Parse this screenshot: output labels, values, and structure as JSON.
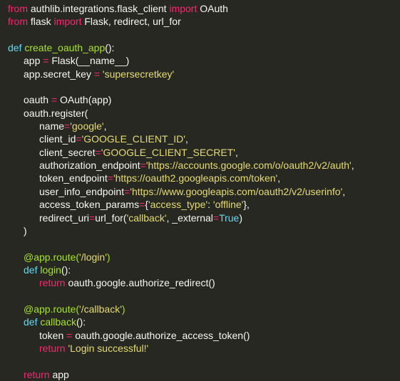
{
  "editor": {
    "language": "python",
    "colors": {
      "background": "#272822",
      "plain": "#f8f8f2",
      "keyword": "#f92672",
      "function": "#a6e22e",
      "string": "#e6db74",
      "operator": "#f92672",
      "builtin": "#66d9ef",
      "decorator": "#a6e22e"
    },
    "lines": [
      {
        "indent": 0,
        "tokens": [
          [
            "kw",
            "from"
          ],
          [
            "pl",
            " authlib.integrations.flask_client "
          ],
          [
            "kw",
            "import"
          ],
          [
            "pl",
            " OAuth"
          ]
        ]
      },
      {
        "indent": 0,
        "tokens": [
          [
            "kw",
            "from"
          ],
          [
            "pl",
            " flask "
          ],
          [
            "kw",
            "import"
          ],
          [
            "pl",
            " Flask, redirect, url_for"
          ]
        ]
      },
      {
        "indent": 0,
        "tokens": []
      },
      {
        "indent": 0,
        "tokens": [
          [
            "bi",
            "def"
          ],
          [
            "pl",
            " "
          ],
          [
            "fn",
            "create_oauth_app"
          ],
          [
            "pl",
            "():"
          ]
        ]
      },
      {
        "indent": 1,
        "tokens": [
          [
            "pl",
            "app "
          ],
          [
            "op",
            "="
          ],
          [
            "pl",
            " Flask(__name__)"
          ]
        ]
      },
      {
        "indent": 1,
        "tokens": [
          [
            "pl",
            "app.secret_key "
          ],
          [
            "op",
            "="
          ],
          [
            "pl",
            " "
          ],
          [
            "str",
            "'supersecretkey'"
          ]
        ]
      },
      {
        "indent": 0,
        "tokens": []
      },
      {
        "indent": 1,
        "tokens": [
          [
            "pl",
            "oauth "
          ],
          [
            "op",
            "="
          ],
          [
            "pl",
            " OAuth(app)"
          ]
        ]
      },
      {
        "indent": 1,
        "tokens": [
          [
            "pl",
            "oauth.register("
          ]
        ]
      },
      {
        "indent": 2,
        "tokens": [
          [
            "pl",
            "name"
          ],
          [
            "op",
            "="
          ],
          [
            "str",
            "'google'"
          ],
          [
            "pl",
            ","
          ]
        ]
      },
      {
        "indent": 2,
        "tokens": [
          [
            "pl",
            "client_id"
          ],
          [
            "op",
            "="
          ],
          [
            "str",
            "'GOOGLE_CLIENT_ID'"
          ],
          [
            "pl",
            ","
          ]
        ]
      },
      {
        "indent": 2,
        "tokens": [
          [
            "pl",
            "client_secret"
          ],
          [
            "op",
            "="
          ],
          [
            "str",
            "'GOOGLE_CLIENT_SECRET'"
          ],
          [
            "pl",
            ","
          ]
        ]
      },
      {
        "indent": 2,
        "tokens": [
          [
            "pl",
            "authorization_endpoint"
          ],
          [
            "op",
            "="
          ],
          [
            "str",
            "'https://accounts.google.com/o/oauth2/v2/auth'"
          ],
          [
            "pl",
            ","
          ]
        ]
      },
      {
        "indent": 2,
        "tokens": [
          [
            "pl",
            "token_endpoint"
          ],
          [
            "op",
            "="
          ],
          [
            "str",
            "'https://oauth2.googleapis.com/token'"
          ],
          [
            "pl",
            ","
          ]
        ]
      },
      {
        "indent": 2,
        "tokens": [
          [
            "pl",
            "user_info_endpoint"
          ],
          [
            "op",
            "="
          ],
          [
            "str",
            "'https://www.googleapis.com/oauth2/v2/userinfo'"
          ],
          [
            "pl",
            ","
          ]
        ]
      },
      {
        "indent": 2,
        "tokens": [
          [
            "pl",
            "access_token_params"
          ],
          [
            "op",
            "="
          ],
          [
            "pl",
            "{"
          ],
          [
            "str",
            "'access_type'"
          ],
          [
            "pl",
            ": "
          ],
          [
            "str",
            "'offline'"
          ],
          [
            "pl",
            "},"
          ]
        ]
      },
      {
        "indent": 2,
        "tokens": [
          [
            "pl",
            "redirect_uri"
          ],
          [
            "op",
            "="
          ],
          [
            "pl",
            "url_for("
          ],
          [
            "str",
            "'callback'"
          ],
          [
            "pl",
            ", _external"
          ],
          [
            "op",
            "="
          ],
          [
            "bi",
            "True"
          ],
          [
            "pl",
            ")"
          ]
        ]
      },
      {
        "indent": 1,
        "tokens": [
          [
            "pl",
            ")"
          ]
        ]
      },
      {
        "indent": 0,
        "tokens": []
      },
      {
        "indent": 1,
        "tokens": [
          [
            "dec",
            "@app.route("
          ],
          [
            "str",
            "'/login'"
          ],
          [
            "dec",
            ")"
          ]
        ]
      },
      {
        "indent": 1,
        "tokens": [
          [
            "bi",
            "def"
          ],
          [
            "pl",
            " "
          ],
          [
            "fn",
            "login"
          ],
          [
            "pl",
            "():"
          ]
        ]
      },
      {
        "indent": 2,
        "tokens": [
          [
            "kw",
            "return"
          ],
          [
            "pl",
            " oauth.google.authorize_redirect()"
          ]
        ]
      },
      {
        "indent": 0,
        "tokens": []
      },
      {
        "indent": 1,
        "tokens": [
          [
            "dec",
            "@app.route("
          ],
          [
            "str",
            "'/callback'"
          ],
          [
            "dec",
            ")"
          ]
        ]
      },
      {
        "indent": 1,
        "tokens": [
          [
            "bi",
            "def"
          ],
          [
            "pl",
            " "
          ],
          [
            "fn",
            "callback"
          ],
          [
            "pl",
            "():"
          ]
        ]
      },
      {
        "indent": 2,
        "tokens": [
          [
            "pl",
            "token "
          ],
          [
            "op",
            "="
          ],
          [
            "pl",
            " oauth.google.authorize_access_token()"
          ]
        ]
      },
      {
        "indent": 2,
        "tokens": [
          [
            "kw",
            "return"
          ],
          [
            "pl",
            " "
          ],
          [
            "str",
            "'Login successful!'"
          ]
        ]
      },
      {
        "indent": 0,
        "tokens": []
      },
      {
        "indent": 1,
        "tokens": [
          [
            "kw",
            "return"
          ],
          [
            "pl",
            " app"
          ]
        ]
      }
    ]
  }
}
